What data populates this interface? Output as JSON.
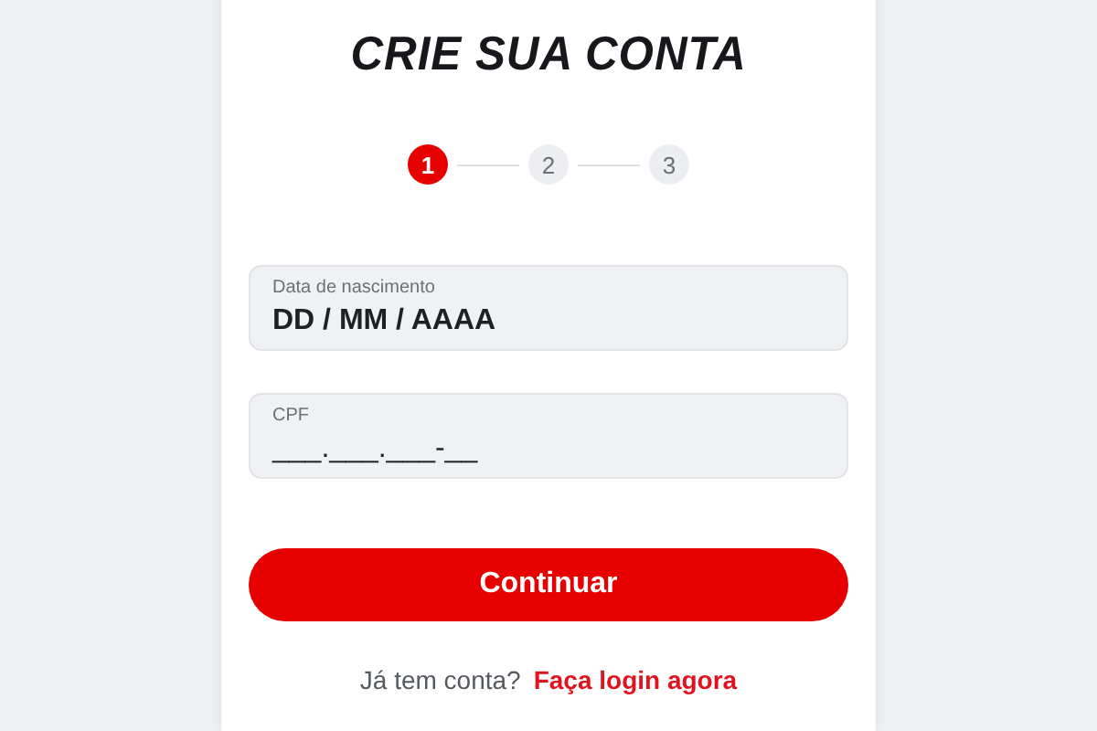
{
  "title": "CRIE SUA CONTA",
  "steps": [
    {
      "label": "1",
      "selected": true
    },
    {
      "label": "2",
      "selected": false
    },
    {
      "label": "3",
      "selected": false
    }
  ],
  "fields": [
    {
      "label": "Data de nascimento",
      "value": "DD / MM / AAAA"
    },
    {
      "label": "CPF",
      "value": "___.___.___-__"
    }
  ],
  "button": "Continuar",
  "footer": {
    "text": "Já tem conta?",
    "link": "Faça login agora"
  }
}
